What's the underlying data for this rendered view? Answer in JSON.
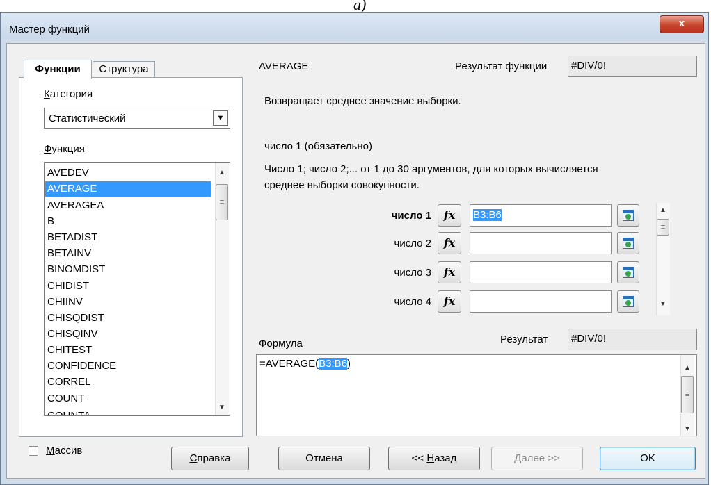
{
  "caption": "а)",
  "window": {
    "title": "Мастер функций",
    "close_glyph": "x"
  },
  "tabs": [
    {
      "label": "Функции"
    },
    {
      "label": "Структура"
    }
  ],
  "category": {
    "label_u": "К",
    "label_rest": "атегория",
    "value": "Статистический"
  },
  "function_list": {
    "label_u": "Ф",
    "label_rest": "ункция",
    "items": [
      "AVEDEV",
      "AVERAGE",
      "AVERAGEA",
      "B",
      "BETADIST",
      "BETAINV",
      "BINOMDIST",
      "CHIDIST",
      "CHIINV",
      "CHISQDIST",
      "CHISQINV",
      "CHITEST",
      "CONFIDENCE",
      "CORREL",
      "COUNT",
      "COUNTA"
    ],
    "selected": "AVERAGE"
  },
  "function_name": "AVERAGE",
  "function_result": {
    "label": "Результат функции",
    "value": "#DIV/0!"
  },
  "description": "Возвращает среднее значение выборки.",
  "argument_title": "число 1 (обязательно)",
  "argument_description_1": "Число 1; число 2;... от 1 до 30 аргументов, для которых вычисляется",
  "argument_description_2": "среднее выборки совокупности.",
  "arguments": [
    {
      "label": "число 1",
      "value": "B3:B6",
      "bold": true
    },
    {
      "label": "число 2",
      "value": ""
    },
    {
      "label": "число 3",
      "value": ""
    },
    {
      "label": "число 4",
      "value": ""
    }
  ],
  "fx_label": "fx",
  "formula": {
    "label": "Формула",
    "prefix": "=AVERAGE(",
    "ref": "B3:B6",
    "suffix": ")"
  },
  "result": {
    "label": "Результат",
    "value": "#DIV/0!"
  },
  "array_checkbox": {
    "label_u": "М",
    "label_rest": "ассив",
    "checked": false
  },
  "buttons": {
    "help": {
      "u": "С",
      "rest": "правка"
    },
    "cancel": "Отмена",
    "back": {
      "pre": "<< ",
      "u": "Н",
      "rest": "азад"
    },
    "next": {
      "u": "Д",
      "rest": "алее >>"
    },
    "ok": "OK"
  }
}
